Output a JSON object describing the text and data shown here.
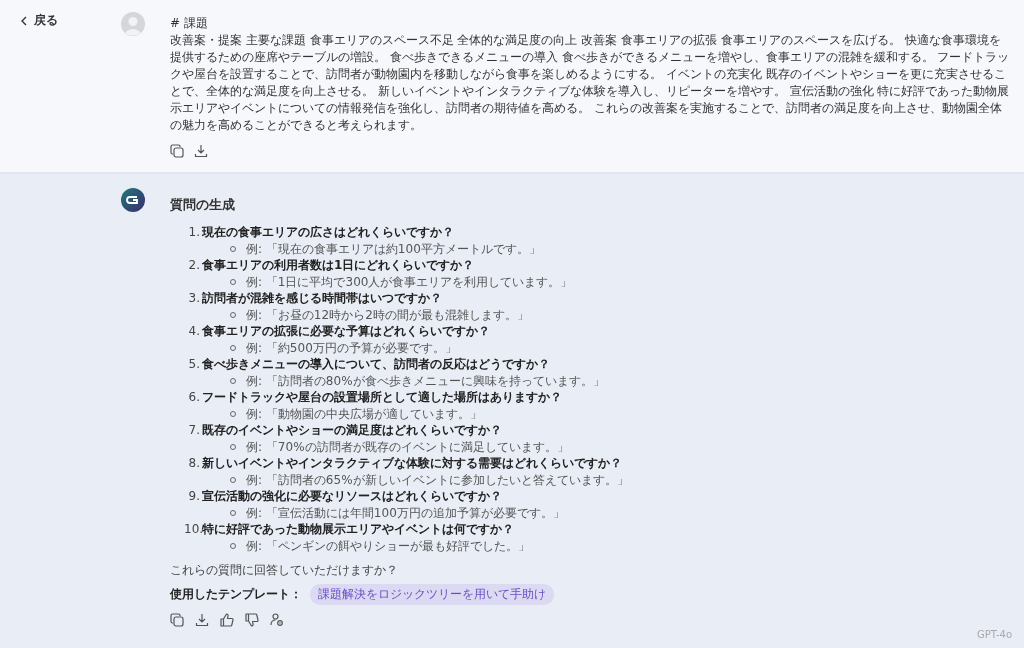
{
  "back": {
    "label": "戻る"
  },
  "user_message": {
    "heading": "# 課題",
    "body": "改善案・提案 主要な課題 食事エリアのスペース不足 全体的な満足度の向上 改善案 食事エリアの拡張 食事エリアのスペースを広げる。 快適な食事環境を提供するための座席やテーブルの増設。 食べ歩きできるメニューの導入 食べ歩きができるメニューを増やし、食事エリアの混雑を緩和する。 フードトラックや屋台を設置することで、訪問者が動物園内を移動しながら食事を楽しめるようにする。 イベントの充実化 既存のイベントやショーを更に充実させることで、全体的な満足度を向上させる。 新しいイベントやインタラクティブな体験を導入し、リピーターを増やす。 宣伝活動の強化 特に好評であった動物展示エリアやイベントについての情報発信を強化し、訪問者の期待値を高める。 これらの改善案を実施することで、訪問者の満足度を向上させ、動物園全体の魅力を高めることができると考えられます。"
  },
  "assistant_message": {
    "title": "質問の生成",
    "questions": [
      {
        "number": "1.",
        "question": "現在の食事エリアの広さはどれくらいですか？",
        "example": "例: 「現在の食事エリアは約100平方メートルです。」"
      },
      {
        "number": "2.",
        "question": "食事エリアの利用者数は1日にどれくらいですか？",
        "example": "例: 「1日に平均で300人が食事エリアを利用しています。」"
      },
      {
        "number": "3.",
        "question": "訪問者が混雑を感じる時間帯はいつですか？",
        "example": "例: 「お昼の12時から2時の間が最も混雑します。」"
      },
      {
        "number": "4.",
        "question": "食事エリアの拡張に必要な予算はどれくらいですか？",
        "example": "例: 「約500万円の予算が必要です。」"
      },
      {
        "number": "5.",
        "question": "食べ歩きメニューの導入について、訪問者の反応はどうですか？",
        "example": "例: 「訪問者の80%が食べ歩きメニューに興味を持っています。」"
      },
      {
        "number": "6.",
        "question": "フードトラックや屋台の設置場所として適した場所はありますか？",
        "example": "例: 「動物園の中央広場が適しています。」"
      },
      {
        "number": "7.",
        "question": "既存のイベントやショーの満足度はどれくらいですか？",
        "example": "例: 「70%の訪問者が既存のイベントに満足しています。」"
      },
      {
        "number": "8.",
        "question": "新しいイベントやインタラクティブな体験に対する需要はどれくらいですか？",
        "example": "例: 「訪問者の65%が新しいイベントに参加したいと答えています。」"
      },
      {
        "number": "9.",
        "question": "宣伝活動の強化に必要なリソースはどれくらいですか？",
        "example": "例: 「宣伝活動には年間100万円の追加予算が必要です。」"
      },
      {
        "number": "10.",
        "question": "特に好評であった動物展示エリアやイベントは何ですか？",
        "example": "例: 「ペンギンの餌やりショーが最も好評でした。」"
      }
    ],
    "closing": "これらの質問に回答していただけますか？",
    "template_label": "使用したテンプレート：",
    "template_tag": "課題解決をロジックツリーを用いて手助け",
    "model": "GPT-4o"
  }
}
